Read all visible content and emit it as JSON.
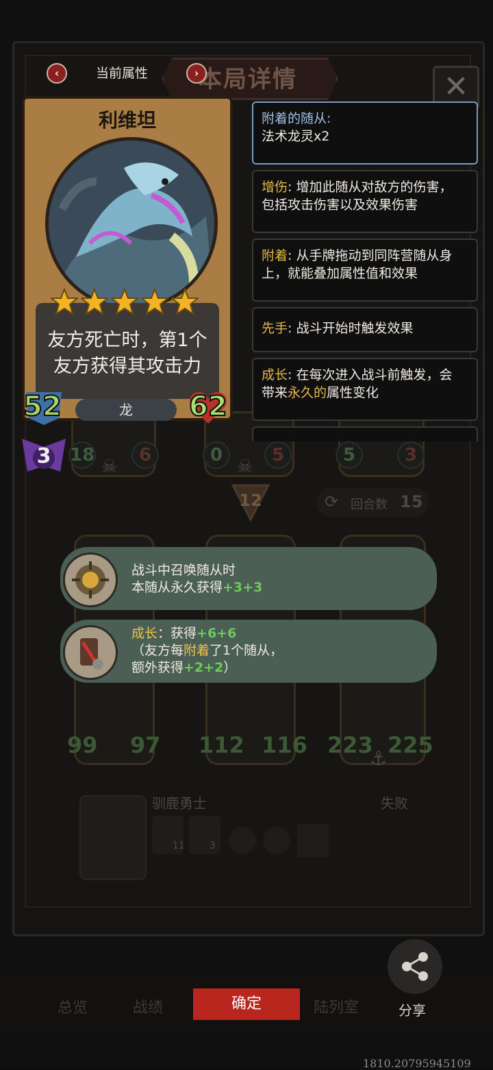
{
  "header": {
    "attributes_label": "当前属性",
    "title": "本局详情",
    "close_icon": "close-icon",
    "prev_icon": "chevron-left-icon",
    "next_icon": "chevron-right-icon"
  },
  "card": {
    "name": "利维坦",
    "stars": 5,
    "description_line1": "友方死亡时，第1个",
    "description_line2": "友方获得其攻击力",
    "attack": "52",
    "health": "62",
    "tribe": "龙",
    "tier": "3"
  },
  "keywords": [
    {
      "key": "附着的随从:",
      "text": "法术龙灵x2"
    },
    {
      "key": "增伤",
      "text_1": ": 增加此随从对敌方的伤害，",
      "text_2": "包括攻击伤害以及效果伤害"
    },
    {
      "key": "附着",
      "text_1": ": 从手牌拖动到同阵营随从身",
      "text_2": "上，就能叠加属性值和效果"
    },
    {
      "key": "先手",
      "text_1": ": 战斗开始时触发效果"
    },
    {
      "key": "成长",
      "text_1": ": 在每次进入战斗前触发，会",
      "text_2a": "带来",
      "text_2_hl": "永久的",
      "text_2b": "属性变化"
    }
  ],
  "board_back": {
    "row1": [
      {
        "atk": "18",
        "hp": "6"
      },
      {
        "atk": "0",
        "hp": "5"
      },
      {
        "atk": "5",
        "hp": "3"
      }
    ],
    "coin_value": "12",
    "round_label": "回合数",
    "round_value": "15",
    "row2": [
      {
        "atk": "99",
        "hp": "97"
      },
      {
        "atk": "112",
        "hp": "116"
      },
      {
        "atk": "223",
        "hp": "225"
      }
    ],
    "opponent_name": "驯鹿勇士",
    "result": "失败",
    "mini_badge_1": "11",
    "mini_badge_2": "3"
  },
  "tips": [
    {
      "line1": "战斗中召唤随从时",
      "line2a": "本随从永久获得",
      "line2b": "+3+3"
    },
    {
      "line1a": "成长",
      "line1b": "：获得",
      "line1c": "+6+6",
      "line2a": "（友方每",
      "line2b": "附着",
      "line2c": "了1个随从，",
      "line3a": "额外获得",
      "line3b": "+2+2",
      "line3c": "）"
    }
  ],
  "bottom": {
    "tab1": "总览",
    "tab2": "战绩",
    "confirm": "确定",
    "tab3": "陆列室",
    "share": "分享",
    "build": "1810.20795945109"
  },
  "colors": {
    "accent_red": "#b8261e",
    "attack_green": "#9fd36a",
    "health_green": "#a6e06e",
    "keyword_gold": "#e7b84a",
    "tip_green": "#4b5f55"
  }
}
